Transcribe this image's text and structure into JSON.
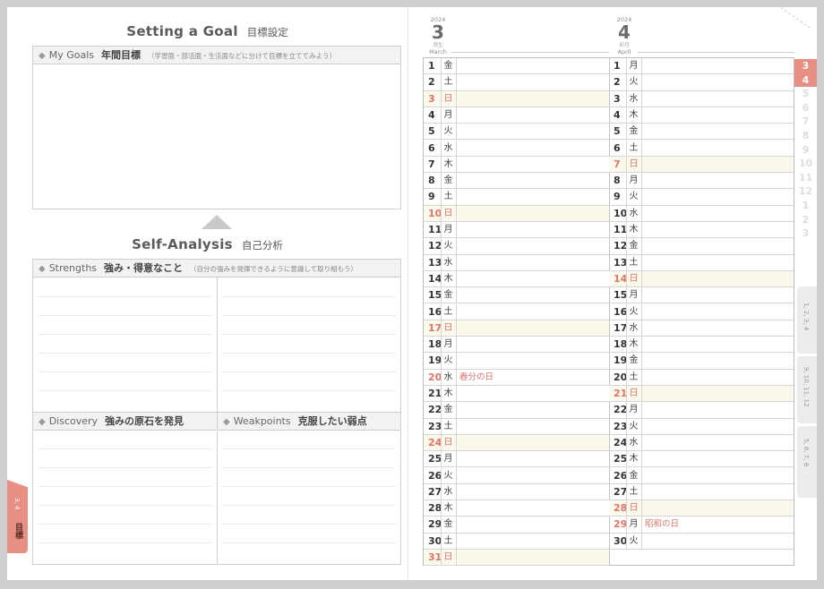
{
  "goal_section": {
    "title_en": "Setting a Goal",
    "title_jp": "目標設定"
  },
  "my_goals": {
    "label_en": "My Goals",
    "label_jp": "年間目標",
    "note": "（学習面・部活面・生活面などに分けて目標を立ててみよう）"
  },
  "analysis_section": {
    "title_en": "Self-Analysis",
    "title_jp": "自己分析"
  },
  "strengths": {
    "label_en": "Strengths",
    "label_jp": "強み・得意なこと",
    "note": "（自分の強みを発揮できるように意識して取り組もう）"
  },
  "discovery": {
    "label_en": "Discovery",
    "label_jp": "強みの原石を発見"
  },
  "weakpoints": {
    "label_en": "Weakpoints",
    "label_jp": "克服したい弱点"
  },
  "left_tab": {
    "months": "3, 4",
    "label": "目標"
  },
  "months": [
    {
      "year": "2024",
      "number": "3",
      "wareki": "弥生",
      "english": "March",
      "days": [
        {
          "d": "1",
          "w": "金",
          "e": ""
        },
        {
          "d": "2",
          "w": "土",
          "e": ""
        },
        {
          "d": "3",
          "w": "日",
          "e": ""
        },
        {
          "d": "4",
          "w": "月",
          "e": ""
        },
        {
          "d": "5",
          "w": "火",
          "e": ""
        },
        {
          "d": "6",
          "w": "水",
          "e": ""
        },
        {
          "d": "7",
          "w": "木",
          "e": ""
        },
        {
          "d": "8",
          "w": "金",
          "e": ""
        },
        {
          "d": "9",
          "w": "土",
          "e": ""
        },
        {
          "d": "10",
          "w": "日",
          "e": ""
        },
        {
          "d": "11",
          "w": "月",
          "e": ""
        },
        {
          "d": "12",
          "w": "火",
          "e": ""
        },
        {
          "d": "13",
          "w": "水",
          "e": ""
        },
        {
          "d": "14",
          "w": "木",
          "e": ""
        },
        {
          "d": "15",
          "w": "金",
          "e": ""
        },
        {
          "d": "16",
          "w": "土",
          "e": ""
        },
        {
          "d": "17",
          "w": "日",
          "e": ""
        },
        {
          "d": "18",
          "w": "月",
          "e": ""
        },
        {
          "d": "19",
          "w": "火",
          "e": ""
        },
        {
          "d": "20",
          "w": "水",
          "e": "春分の日"
        },
        {
          "d": "21",
          "w": "木",
          "e": ""
        },
        {
          "d": "22",
          "w": "金",
          "e": ""
        },
        {
          "d": "23",
          "w": "土",
          "e": ""
        },
        {
          "d": "24",
          "w": "日",
          "e": ""
        },
        {
          "d": "25",
          "w": "月",
          "e": ""
        },
        {
          "d": "26",
          "w": "火",
          "e": ""
        },
        {
          "d": "27",
          "w": "水",
          "e": ""
        },
        {
          "d": "28",
          "w": "木",
          "e": ""
        },
        {
          "d": "29",
          "w": "金",
          "e": ""
        },
        {
          "d": "30",
          "w": "土",
          "e": ""
        },
        {
          "d": "31",
          "w": "日",
          "e": ""
        }
      ]
    },
    {
      "year": "2024",
      "number": "4",
      "wareki": "卯月",
      "english": "April",
      "days": [
        {
          "d": "1",
          "w": "月",
          "e": ""
        },
        {
          "d": "2",
          "w": "火",
          "e": ""
        },
        {
          "d": "3",
          "w": "水",
          "e": ""
        },
        {
          "d": "4",
          "w": "木",
          "e": ""
        },
        {
          "d": "5",
          "w": "金",
          "e": ""
        },
        {
          "d": "6",
          "w": "土",
          "e": ""
        },
        {
          "d": "7",
          "w": "日",
          "e": ""
        },
        {
          "d": "8",
          "w": "月",
          "e": ""
        },
        {
          "d": "9",
          "w": "火",
          "e": ""
        },
        {
          "d": "10",
          "w": "水",
          "e": ""
        },
        {
          "d": "11",
          "w": "木",
          "e": ""
        },
        {
          "d": "12",
          "w": "金",
          "e": ""
        },
        {
          "d": "13",
          "w": "土",
          "e": ""
        },
        {
          "d": "14",
          "w": "日",
          "e": ""
        },
        {
          "d": "15",
          "w": "月",
          "e": ""
        },
        {
          "d": "16",
          "w": "火",
          "e": ""
        },
        {
          "d": "17",
          "w": "水",
          "e": ""
        },
        {
          "d": "18",
          "w": "木",
          "e": ""
        },
        {
          "d": "19",
          "w": "金",
          "e": ""
        },
        {
          "d": "20",
          "w": "土",
          "e": ""
        },
        {
          "d": "21",
          "w": "日",
          "e": ""
        },
        {
          "d": "22",
          "w": "月",
          "e": ""
        },
        {
          "d": "23",
          "w": "火",
          "e": ""
        },
        {
          "d": "24",
          "w": "水",
          "e": ""
        },
        {
          "d": "25",
          "w": "木",
          "e": ""
        },
        {
          "d": "26",
          "w": "金",
          "e": ""
        },
        {
          "d": "27",
          "w": "土",
          "e": ""
        },
        {
          "d": "28",
          "w": "日",
          "e": ""
        },
        {
          "d": "29",
          "w": "月",
          "e": "昭和の日"
        },
        {
          "d": "30",
          "w": "火",
          "e": ""
        }
      ]
    }
  ],
  "month_tabs": [
    "3",
    "4",
    "5",
    "6",
    "7",
    "8",
    "9",
    "10",
    "11",
    "12",
    "1",
    "2",
    "3"
  ],
  "active_tabs": [
    "3",
    "4"
  ],
  "side_tab_groups": [
    "1, 2, 3, 4",
    "9, 10, 11, 12",
    "5, 6, 7, 8"
  ],
  "colors": {
    "accent": "#e88f84",
    "holiday_text": "#e0756a",
    "sunday_bg": "#fbf8ec"
  }
}
